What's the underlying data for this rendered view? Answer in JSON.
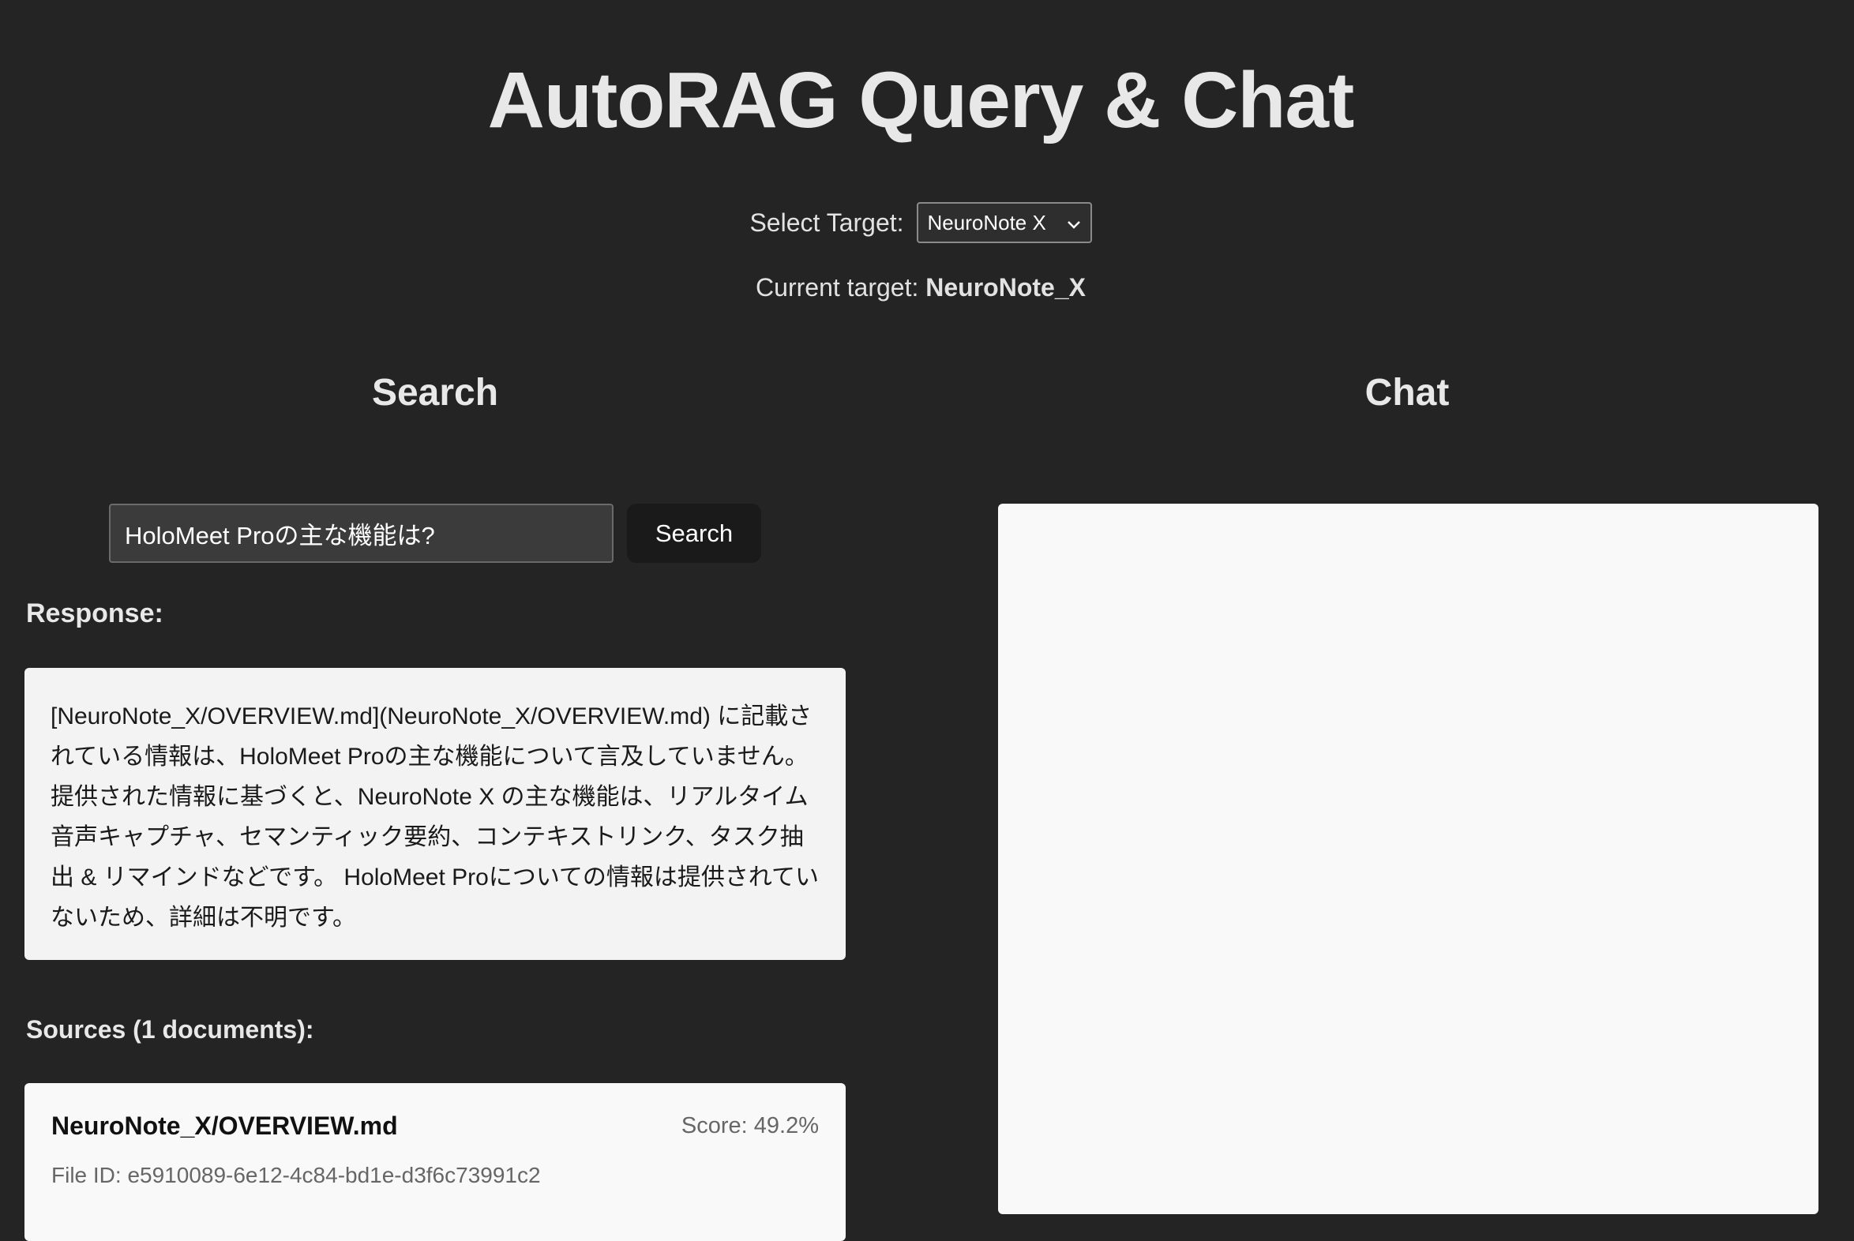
{
  "header": {
    "title": "AutoRAG Query & Chat"
  },
  "target": {
    "label": "Select Target:",
    "selected": "NeuroNote X",
    "current_label": "Current target:",
    "current_value": "NeuroNote_X"
  },
  "search": {
    "heading": "Search",
    "input_value": "HoloMeet Proの主な機能は?",
    "button_label": "Search",
    "response_label": "Response:",
    "response_text": "[NeuroNote_X/OVERVIEW.md](NeuroNote_X/OVERVIEW.md) に記載されている情報は、HoloMeet Proの主な機能について言及していません。 提供された情報に基づくと、NeuroNote X の主な機能は、リアルタイム音声キャプチャ、セマンティック要約、コンテキストリンク、タスク抽出 & リマインドなどです。 HoloMeet Proについての情報は提供されていないため、詳細は不明です。",
    "sources_label": "Sources (1 documents):",
    "sources": [
      {
        "name": "NeuroNote_X/OVERVIEW.md",
        "score": "Score: 49.2%",
        "file_id": "File ID: e5910089-6e12-4c84-bd1e-d3f6c73991c2"
      }
    ]
  },
  "chat": {
    "heading": "Chat"
  }
}
